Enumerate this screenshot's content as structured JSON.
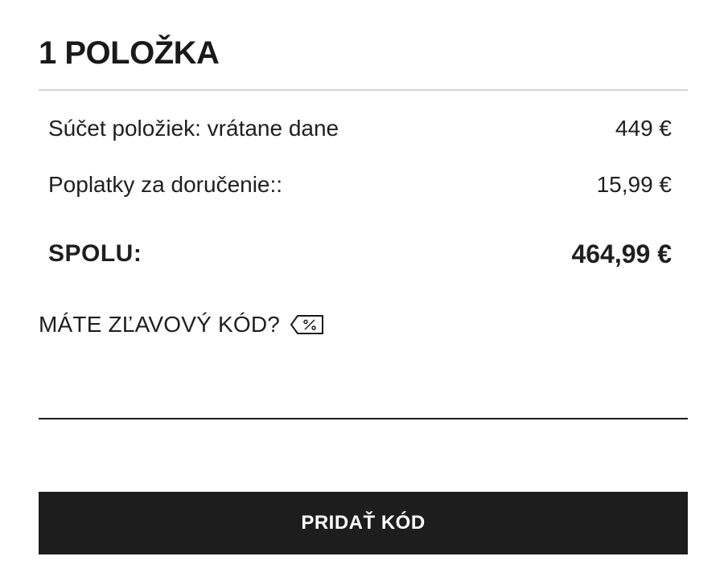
{
  "cart": {
    "heading": "1 POLOŽKA"
  },
  "summary": {
    "subtotal_label": "Súčet položiek: vrátane dane",
    "subtotal_value": "449 €",
    "shipping_label": "Poplatky za doručenie::",
    "shipping_value": "15,99 €",
    "total_label": "SPOLU:",
    "total_value": "464,99 €"
  },
  "discount": {
    "label": "MÁTE ZĽAVOVÝ KÓD?",
    "icon": "discount-tag-icon",
    "input_value": "",
    "button_label": "PRIDAŤ KÓD"
  },
  "colors": {
    "text": "#1a1a1a",
    "divider": "#d4d4d4",
    "button_bg": "#1e1d1d",
    "button_text": "#ffffff"
  }
}
